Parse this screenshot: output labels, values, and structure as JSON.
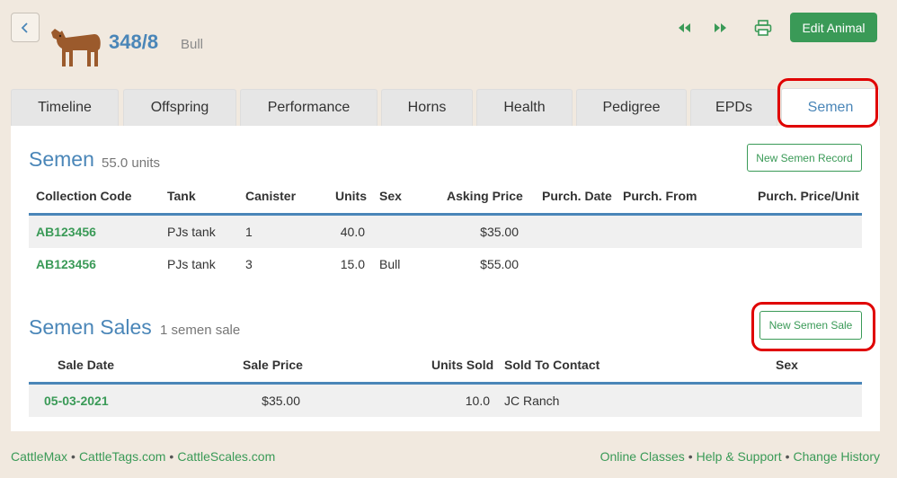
{
  "header": {
    "animal_id": "348/8",
    "animal_type": "Bull",
    "edit_label": "Edit Animal",
    "icons": [
      "chevron-left-icon",
      "cow-icon",
      "rewind-icon",
      "fast-forward-icon",
      "print-icon"
    ]
  },
  "tabs": [
    {
      "label": "Timeline"
    },
    {
      "label": "Offspring"
    },
    {
      "label": "Performance"
    },
    {
      "label": "Horns"
    },
    {
      "label": "Health"
    },
    {
      "label": "Pedigree"
    },
    {
      "label": "EPDs"
    },
    {
      "label": "Semen",
      "active": true
    }
  ],
  "semen": {
    "title": "Semen",
    "subtitle": "55.0 units",
    "new_button": "New Semen Record",
    "columns": [
      "Collection Code",
      "Tank",
      "Canister",
      "Units",
      "Sex",
      "Asking Price",
      "Purch. Date",
      "Purch. From",
      "Purch. Price/Unit"
    ],
    "rows": [
      {
        "code": "AB123456",
        "tank": "PJs tank",
        "canister": "1",
        "units": "40.0",
        "sex": "",
        "price": "$35.00",
        "purch_date": "",
        "purch_from": "",
        "purch_price": ""
      },
      {
        "code": "AB123456",
        "tank": "PJs tank",
        "canister": "3",
        "units": "15.0",
        "sex": "Bull",
        "price": "$55.00",
        "purch_date": "",
        "purch_from": "",
        "purch_price": ""
      }
    ]
  },
  "sales": {
    "title": "Semen Sales",
    "subtitle": "1 semen sale",
    "new_button": "New Semen Sale",
    "columns": [
      "Sale Date",
      "Sale Price",
      "Units Sold",
      "Sold To Contact",
      "Sex"
    ],
    "rows": [
      {
        "date": "05-03-2021",
        "price": "$35.00",
        "units": "10.0",
        "contact": "JC Ranch",
        "sex": ""
      }
    ]
  },
  "footer": {
    "left": [
      "CattleMax",
      "CattleTags.com",
      "CattleScales.com"
    ],
    "right": [
      "Online Classes",
      "Help & Support",
      "Change History"
    ],
    "separator": "•"
  },
  "colors": {
    "background": "#f1e9df",
    "accent_blue": "#4a86b8",
    "accent_green": "#3a9a57",
    "highlight_red": "#e00000"
  }
}
